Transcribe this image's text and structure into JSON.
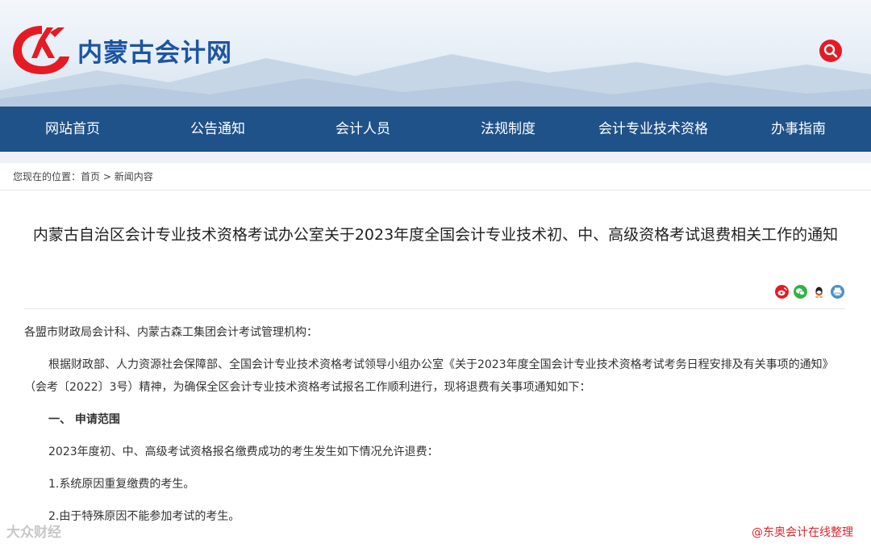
{
  "header": {
    "site_name": "内蒙古会计网"
  },
  "nav": {
    "items": [
      {
        "label": "网站首页"
      },
      {
        "label": "公告通知"
      },
      {
        "label": "会计人员"
      },
      {
        "label": "法规制度"
      },
      {
        "label": "会计专业技术资格"
      },
      {
        "label": "办事指南"
      }
    ]
  },
  "breadcrumb": {
    "prefix": "您现在的位置：",
    "home": "首页",
    "separator": ">",
    "current": "新闻内容"
  },
  "article": {
    "title": "内蒙古自治区会计专业技术资格考试办公室关于2023年度全国会计专业技术初、中、高级资格考试退费相关工作的通知",
    "share_icons": [
      "weibo-icon",
      "wechat-icon",
      "qq-icon",
      "print-icon"
    ],
    "paragraphs": [
      {
        "text": "各盟市财政局会计科、内蒙古森工集团会计考试管理机构：",
        "style": "plain"
      },
      {
        "text": "根据财政部、人力资源社会保障部、全国会计专业技术资格考试领导小组办公室《关于2023年度全国会计专业技术资格考试考务日程安排及有关事项的通知》（会考〔2022〕3号）精神，为确保全区会计专业技术资格考试报名工作顺利进行，现将退费有关事项通知如下：",
        "style": "indent"
      },
      {
        "text": "一、 申请范围",
        "style": "bold-indent"
      },
      {
        "text": "2023年度初、中、高级考试资格报名缴费成功的考生发生如下情况允许退费：",
        "style": "indent"
      },
      {
        "text": "1.系统原因重复缴费的考生。",
        "style": "indent"
      },
      {
        "text": "2.由于特殊原因不能参加考试的考生。",
        "style": "indent"
      }
    ]
  },
  "watermarks": {
    "left": "大众财经",
    "right": "@东奥会计在线整理"
  },
  "colors": {
    "nav_bg": "#1f5288",
    "brand_blue": "#1c55a1",
    "logo_red": "#e51b24"
  }
}
